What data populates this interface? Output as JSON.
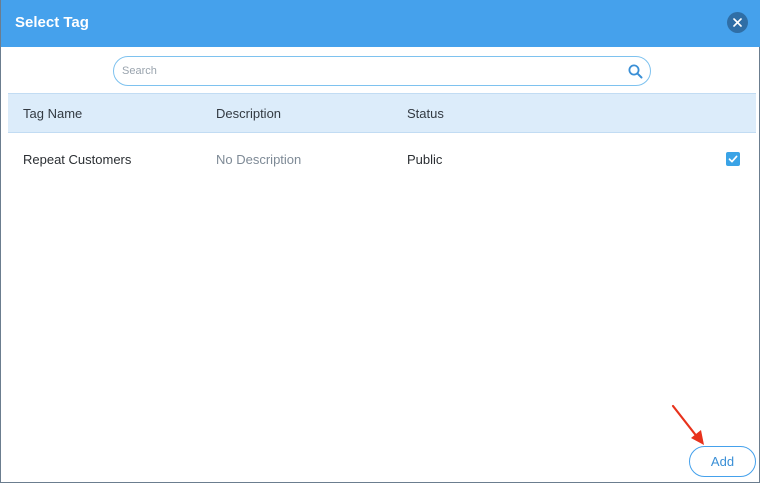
{
  "dialog": {
    "title": "Select Tag",
    "close_icon": "close-icon"
  },
  "search": {
    "placeholder": "Search",
    "value": "",
    "icon": "search-icon"
  },
  "table": {
    "columns": [
      "Tag Name",
      "Description",
      "Status"
    ],
    "rows": [
      {
        "tag_name": "Repeat Customers",
        "description": "No Description",
        "status": "Public",
        "checked": true
      }
    ]
  },
  "footer": {
    "add_label": "Add"
  },
  "colors": {
    "header": "#45a1ec",
    "table_header": "#dcecfa",
    "checkbox": "#3aa3e6",
    "annotation_arrow": "#e8321c"
  }
}
